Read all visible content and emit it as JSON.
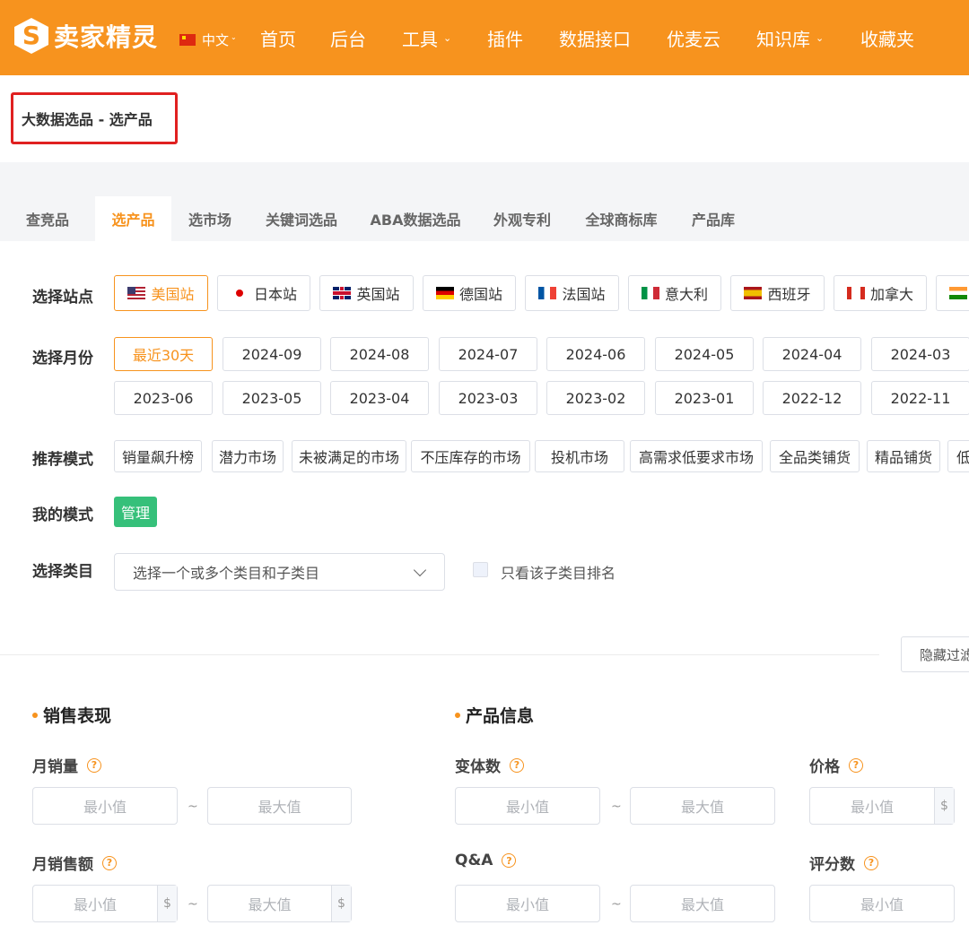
{
  "nav": {
    "logo_mark": "S",
    "logo_text": "卖家精灵",
    "lang": "中文",
    "items": [
      {
        "label": "首页",
        "caret": false
      },
      {
        "label": "后台",
        "caret": false
      },
      {
        "label": "工具",
        "caret": true
      },
      {
        "label": "插件",
        "caret": false
      },
      {
        "label": "数据接口",
        "caret": false
      },
      {
        "label": "优麦云",
        "caret": false
      },
      {
        "label": "知识库",
        "caret": true
      },
      {
        "label": "收藏夹",
        "caret": false
      }
    ]
  },
  "breadcrumb": "大数据选品 - 选产品",
  "tabs": [
    "查竞品",
    "选产品",
    "选市场",
    "关键词选品",
    "ABA数据选品",
    "外观专利",
    "全球商标库",
    "产品库"
  ],
  "active_tab": 1,
  "filters": {
    "site_label": "选择站点",
    "sites": [
      "美国站",
      "日本站",
      "英国站",
      "德国站",
      "法国站",
      "意大利",
      "西班牙",
      "加拿大",
      ""
    ],
    "active_site": 0,
    "month_label": "选择月份",
    "months_row1": [
      "最近30天",
      "2024-09",
      "2024-08",
      "2024-07",
      "2024-06",
      "2024-05",
      "2024-04",
      "2024-03"
    ],
    "months_row2": [
      "2023-06",
      "2023-05",
      "2023-04",
      "2023-03",
      "2023-02",
      "2023-01",
      "2022-12",
      "2022-11"
    ],
    "active_month": 0,
    "mode_label": "推荐模式",
    "modes": [
      "销量飙升榜",
      "潜力市场",
      "未被满足的市场",
      "不压库存的市场",
      "投机市场",
      "高需求低要求市场",
      "全品类铺货",
      "精品铺货",
      "低"
    ],
    "my_mode_label": "我的模式",
    "manage_label": "管理",
    "category_label": "选择类目",
    "category_placeholder": "选择一个或多个类目和子类目",
    "subcategory_only_label": "只看该子类目排名",
    "hide_filters_label": "隐藏过滤"
  },
  "sections": {
    "sales": {
      "title": "销售表现",
      "monthly_sales": "月销量",
      "monthly_revenue": "月销售额"
    },
    "product": {
      "title": "产品信息",
      "variants": "变体数",
      "qa": "Q&A",
      "price": "价格",
      "rating_count": "评分数"
    },
    "min_placeholder": "最小值",
    "max_placeholder": "最大值",
    "currency": "$",
    "tilde": "~",
    "help": "?"
  },
  "colors": {
    "brand": "#f7931e",
    "highlight_border": "#e02020",
    "manage_bg": "#36c07a"
  }
}
